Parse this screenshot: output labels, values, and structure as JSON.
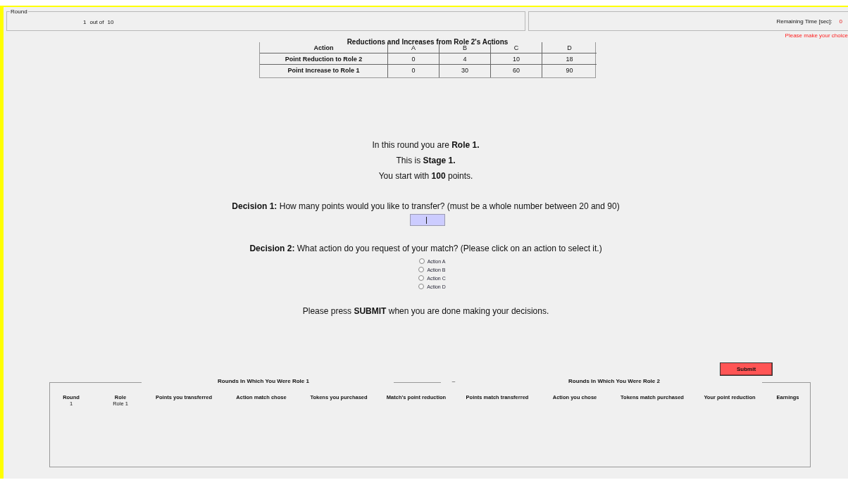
{
  "round_panel": {
    "legend": "Round",
    "current": "1",
    "separator": "out of",
    "total": "10"
  },
  "timer_panel": {
    "label": "Remaining Time [sec]:",
    "value": "0"
  },
  "warning": "Please make your choice",
  "actions_table": {
    "title": "Reductions and Increases from Role 2's Actions",
    "columns": [
      "Action",
      "A",
      "B",
      "C",
      "D"
    ],
    "rows": [
      [
        "Point Reduction to Role 2",
        "0",
        "4",
        "10",
        "18"
      ],
      [
        "Point Increase to Role 1",
        "0",
        "30",
        "60",
        "90"
      ]
    ]
  },
  "info_lines": [
    "In this round you are **Role 1.**",
    "This is **Stage 1.**",
    "You start with **100** points."
  ],
  "decision_1": {
    "prompt": "**Decision 1:** How many points would you like to transfer? (must be a whole number between 20 and 90)",
    "focused": true
  },
  "decision_2": {
    "prompt": "**Decision 2:** What action do you request of your match? (Please click on an action to select it.)",
    "options": [
      {
        "label": "Action A",
        "selected": false
      },
      {
        "label": "Action B",
        "selected": false
      },
      {
        "label": "Action C",
        "selected": false
      },
      {
        "label": "Action D",
        "selected": false
      }
    ]
  },
  "instruction": "Please press **SUBMIT** when you are done making your decisions.",
  "submit_button": "Submit",
  "history": {
    "group_titles": [
      "Rounds In Which You Were Role 1",
      "–",
      "Rounds In Which You Were Role 2"
    ],
    "columns": [
      "Round",
      "Role",
      "Points you transferred",
      "Action match chose",
      "Tokens you purchased",
      "Match's point reduction",
      "Points match transferred",
      "Action you chose",
      "Tokens match purchased",
      "Your point reduction",
      "Earnings"
    ],
    "rows": [
      [
        "1",
        "Role 1"
      ]
    ]
  }
}
